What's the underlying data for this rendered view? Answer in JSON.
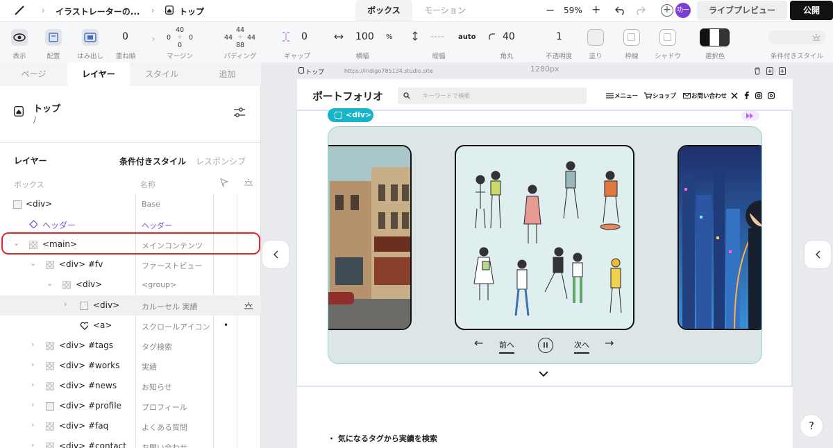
{
  "topbar": {
    "project_name": "イラストレーターの...",
    "page_name": "トップ",
    "tabs": [
      {
        "label": "ボックス",
        "active": true
      },
      {
        "label": "モーション",
        "active": false
      }
    ],
    "zoom": "59%",
    "avatar_label": "功一",
    "preview_label": "ライブプレビュー",
    "publish_label": "公開"
  },
  "toolbar": {
    "labels": {
      "show": "表示",
      "align": "配置",
      "overflow": "はみ出し",
      "z_order": "重ね順",
      "margin": "マージン",
      "padding": "パディング",
      "gap": "ギャップ",
      "width": "横幅",
      "height": "縦幅",
      "radius": "角丸",
      "opacity": "不透明度",
      "fill": "塗り",
      "border": "枠線",
      "shadow": "シャドウ",
      "selection_color": "選択色",
      "conditional_style": "条件付きスタイル"
    },
    "z_order_value": "0",
    "margin": {
      "top": "40",
      "right": "0",
      "bottom": "0",
      "left": "0"
    },
    "padding": {
      "top": "44",
      "right": "44",
      "bottom": "88",
      "left": "44"
    },
    "gap_value": "0",
    "width_value": "100",
    "width_unit": "%",
    "height_value": "----",
    "height_unit": "auto",
    "radius_value": "40",
    "opacity_value": "1"
  },
  "left_panel": {
    "tabs": [
      {
        "label": "ページ",
        "active": false
      },
      {
        "label": "レイヤー",
        "active": true
      },
      {
        "label": "スタイル",
        "active": false
      },
      {
        "label": "追加",
        "active": false
      }
    ],
    "page_title": "トップ",
    "page_path": "/",
    "layer_heading": "レイヤー",
    "conditional_style_tab": "条件付きスタイル",
    "responsive_tab": "レスポンシブ",
    "col_box": "ボックス",
    "col_name": "名称",
    "layers": [
      {
        "tag": "<div>",
        "name": "Base"
      },
      {
        "tag": "ヘッダー",
        "name": "ヘッダー"
      },
      {
        "tag": "<main>",
        "name": "メインコンテンツ"
      },
      {
        "tag": "<div> #fv",
        "name": "ファーストビュー"
      },
      {
        "tag": "<div>",
        "name": "<group>"
      },
      {
        "tag": "<div>",
        "name": "カルーセル 実績"
      },
      {
        "tag": "<a>",
        "name": "スクロールアイコン"
      },
      {
        "tag": "<div> #tags",
        "name": "タグ検索"
      },
      {
        "tag": "<div> #works",
        "name": "実績"
      },
      {
        "tag": "<div> #news",
        "name": "お知らせ"
      },
      {
        "tag": "<div> #profile",
        "name": "プロフィール"
      },
      {
        "tag": "<div> #faq",
        "name": "よくある質問"
      },
      {
        "tag": "<div> #contact",
        "name": "お問い合わせ"
      }
    ]
  },
  "canvas": {
    "page_label": "トップ",
    "url": "https://indigo785134.studio.site",
    "width_label": "1280px",
    "site": {
      "logo": "ポートフォリオ",
      "search_placeholder": "キーワードで検索",
      "nav": {
        "menu": "メニュー",
        "shop": "ショップ",
        "contact": "お問い合わせ"
      },
      "selected_badge": "<div>",
      "carousel": {
        "prev": "前へ",
        "next": "次へ"
      },
      "tag_search_title": "・ 気になるタグから実績を検索"
    }
  },
  "colors": {
    "accent_teal": "#16b6ca",
    "purple": "#7c3fd6",
    "selection_red": "#e0252b"
  }
}
